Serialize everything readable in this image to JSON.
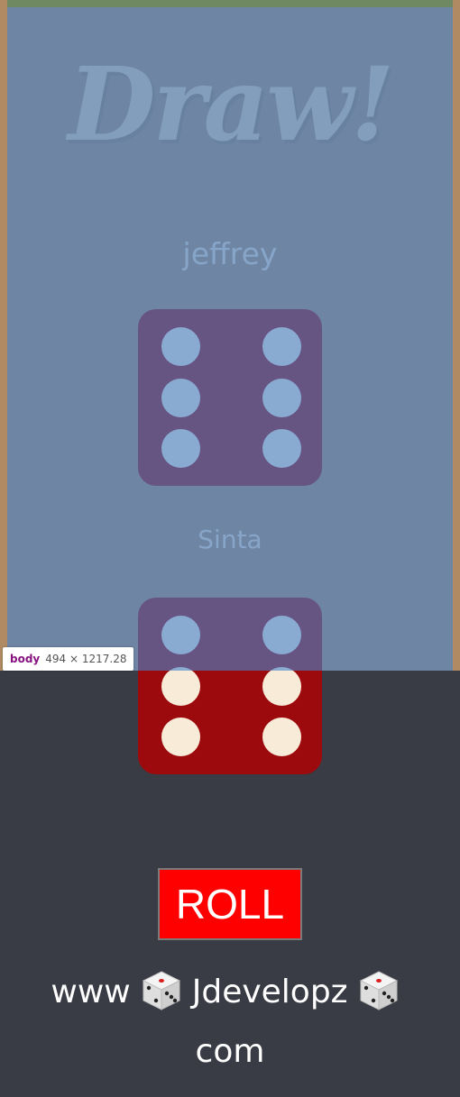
{
  "app": {
    "title": "Draw!",
    "players": [
      {
        "name": "jeffrey",
        "die_value": 6
      },
      {
        "name": "Sinta",
        "die_value": 6
      }
    ],
    "roll_label": "ROLL"
  },
  "footer": {
    "part1": "www",
    "part2": "Jdevelopz",
    "part3": "com"
  },
  "devtools": {
    "tag": "body",
    "dims": "494 × 1217.28"
  },
  "colors": {
    "die": "#9c0a0d",
    "pip": "#f8ebd7",
    "roll_button": "#ff0000",
    "footer_bg": "#393c44",
    "highlight_overlay": "#4582cd"
  }
}
